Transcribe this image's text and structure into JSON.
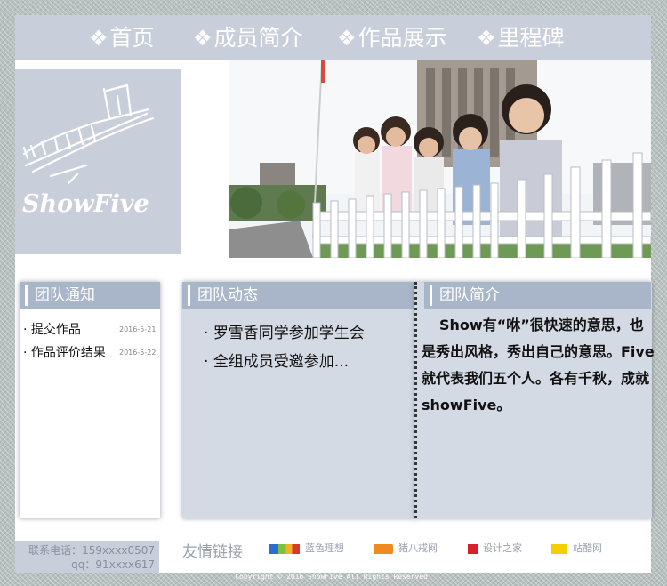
{
  "nav": {
    "items": [
      {
        "icon": "❖",
        "label": "首页"
      },
      {
        "icon": "❖",
        "label": "成员简介"
      },
      {
        "icon": "❖",
        "label": "作品展示"
      },
      {
        "icon": "❖",
        "label": "里程碑"
      }
    ]
  },
  "banner": {
    "logo_text": "ShowFive"
  },
  "notice": {
    "title": "团队通知",
    "items": [
      {
        "label": "提交作品",
        "date": "2016-5-21"
      },
      {
        "label": "作品评价结果",
        "date": "2016-5-22"
      }
    ]
  },
  "news": {
    "title": "团队动态",
    "items": [
      {
        "label": "罗雪香同学参加学生会"
      },
      {
        "label": "全组成员受邀参加..."
      }
    ]
  },
  "intro": {
    "title": "团队简介",
    "text": "Show有“咻”很快速的意思，也是秀出风格，秀出自己的意思。Five就代表我们五个人。各有千秋，成就showFive。"
  },
  "footer": {
    "phone": "联系电话：159xxxx0507",
    "qq": "qq：91xxxx617",
    "links_title": "友情链接",
    "links": [
      {
        "label": "蓝色理想"
      },
      {
        "label": "猪八戒网"
      },
      {
        "label": "设计之家"
      },
      {
        "label": "站酷网"
      }
    ],
    "copyright": "Copyright © 2016 ShowFive All Rights Reserved."
  },
  "colors": {
    "nav_bg": "#c8cfdb",
    "panel_head": "#a9b5c8",
    "panel_bg": "#d3dae4",
    "page_bg": "#b9c1c0"
  }
}
